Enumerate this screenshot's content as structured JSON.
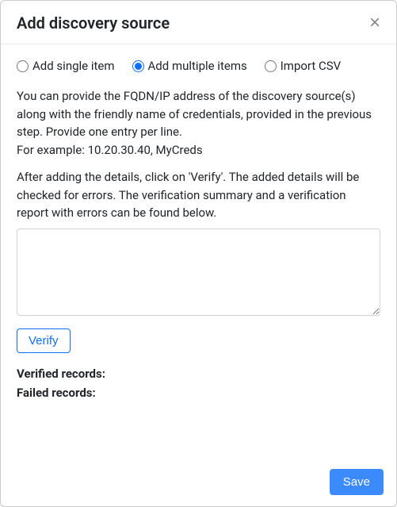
{
  "header": {
    "title": "Add discovery source",
    "close_glyph": "×"
  },
  "radios": {
    "single": {
      "label": "Add single item",
      "checked": false
    },
    "multiple": {
      "label": "Add multiple items",
      "checked": true
    },
    "csv": {
      "label": "Import CSV",
      "checked": false
    }
  },
  "instructions": {
    "para1_line1": "You can provide the FQDN/IP address of the discovery source(s) along with the friendly name of credentials, provided in the previous step. Provide one entry per line.",
    "para1_line2": "For example: 10.20.30.40, MyCreds",
    "para2": "After adding the details, click on 'Verify'. The added details will be checked for errors. The verification summary and a verification report with errors can be found below."
  },
  "textarea": {
    "value": "",
    "placeholder": ""
  },
  "buttons": {
    "verify_label": "Verify",
    "save_label": "Save"
  },
  "records": {
    "verified_label": "Verified records:",
    "verified_value": "",
    "failed_label": "Failed records:",
    "failed_value": ""
  }
}
